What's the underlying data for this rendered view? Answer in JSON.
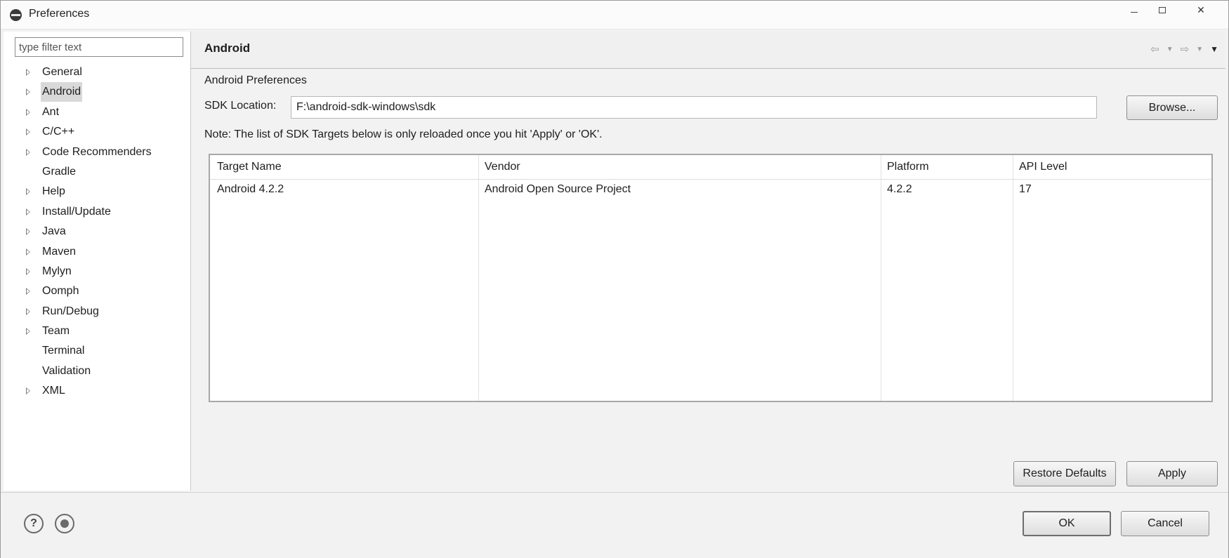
{
  "window": {
    "title": "Preferences"
  },
  "filter": {
    "placeholder": "type filter text"
  },
  "tree": [
    {
      "label": "General",
      "expandable": true,
      "selected": false
    },
    {
      "label": "Android",
      "expandable": true,
      "selected": true
    },
    {
      "label": "Ant",
      "expandable": true,
      "selected": false
    },
    {
      "label": "C/C++",
      "expandable": true,
      "selected": false
    },
    {
      "label": "Code Recommenders",
      "expandable": true,
      "selected": false
    },
    {
      "label": "Gradle",
      "expandable": false,
      "selected": false
    },
    {
      "label": "Help",
      "expandable": true,
      "selected": false
    },
    {
      "label": "Install/Update",
      "expandable": true,
      "selected": false
    },
    {
      "label": "Java",
      "expandable": true,
      "selected": false
    },
    {
      "label": "Maven",
      "expandable": true,
      "selected": false
    },
    {
      "label": "Mylyn",
      "expandable": true,
      "selected": false
    },
    {
      "label": "Oomph",
      "expandable": true,
      "selected": false
    },
    {
      "label": "Run/Debug",
      "expandable": true,
      "selected": false
    },
    {
      "label": "Team",
      "expandable": true,
      "selected": false
    },
    {
      "label": "Terminal",
      "expandable": false,
      "selected": false
    },
    {
      "label": "Validation",
      "expandable": false,
      "selected": false
    },
    {
      "label": "XML",
      "expandable": true,
      "selected": false
    }
  ],
  "page": {
    "title": "Android",
    "section_label": "Android Preferences",
    "sdk_label": "SDK Location:",
    "sdk_value": "F:\\android-sdk-windows\\sdk",
    "browse_label": "Browse...",
    "note": "Note: The list of SDK Targets below is only reloaded once you hit 'Apply' or 'OK'.",
    "restore_label": "Restore Defaults",
    "apply_label": "Apply"
  },
  "nav_icons": [
    "back-arrow-icon",
    "dropdown-icon",
    "forward-arrow-icon",
    "dropdown-icon",
    "view-menu-icon"
  ],
  "table": {
    "columns": [
      "Target Name",
      "Vendor",
      "Platform",
      "API Level"
    ],
    "rows": [
      [
        "Android 4.2.2",
        "Android Open Source Project",
        "4.2.2",
        "17"
      ]
    ]
  },
  "footer": {
    "ok_label": "OK",
    "cancel_label": "Cancel",
    "help_icon": "help-icon",
    "record_icon": "record-icon"
  }
}
